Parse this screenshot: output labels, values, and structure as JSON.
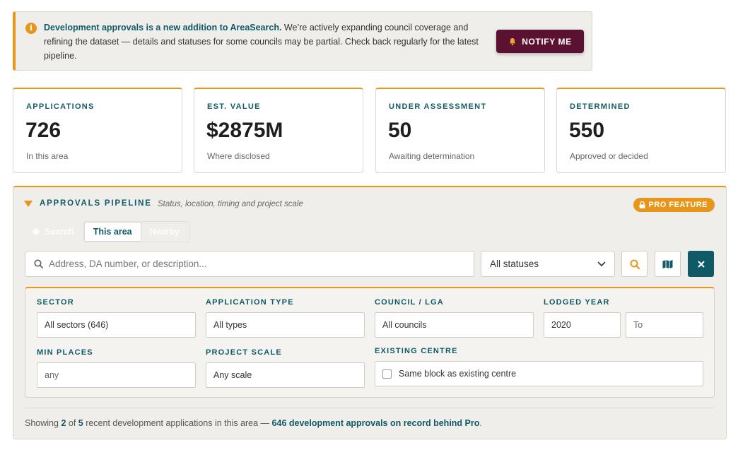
{
  "banner": {
    "icon": "info-icon",
    "headline": "Development approvals is a new addition to AreaSearch.",
    "body": " We’re actively expanding council coverage and refining the dataset — details and statuses for some councils may be partial. Check back regularly for the latest pipeline.",
    "button_label": "NOTIFY ME",
    "button_icon": "bell-icon"
  },
  "stats": [
    {
      "label": "APPLICATIONS",
      "value": "726",
      "sub": "In this area"
    },
    {
      "label": "EST. VALUE",
      "value": "$2875M",
      "sub": "Where disclosed"
    },
    {
      "label": "UNDER ASSESSMENT",
      "value": "50",
      "sub": "Awaiting determination"
    },
    {
      "label": "DETERMINED",
      "value": "550",
      "sub": "Approved or decided"
    }
  ],
  "panel": {
    "title": "APPROVALS PIPELINE",
    "subtitle": "Status, location, timing and project scale",
    "badge": "PRO FEATURE",
    "tabs": [
      "Search",
      "This area",
      "Nearby"
    ],
    "active_tab": "This area",
    "search_placeholder": "Address, DA number, or description...",
    "status_value": "All statuses",
    "filters": {
      "sector_label": "SECTOR",
      "sector_value": "All sectors (646)",
      "app_type_label": "APPLICATION TYPE",
      "app_type_value": "All types",
      "council_label": "COUNCIL / LGA",
      "council_value": "All councils",
      "lodged_label": "LODGED YEAR",
      "lodged_from": "2020",
      "lodged_to_placeholder": "To",
      "min_places_label": "MIN PLACES",
      "min_places_placeholder": "any",
      "scale_label": "PROJECT SCALE",
      "scale_value": "Any scale",
      "centre_label": "EXISTING CENTRE",
      "centre_checkbox": "Same block as existing centre"
    },
    "footer": {
      "prefix": "Showing ",
      "shown": "2",
      "of": " of ",
      "total": "5",
      "middle": " recent development applications in this area — ",
      "link": "646 development approvals on record behind Pro",
      "suffix": "."
    }
  },
  "colors": {
    "accent": "#e8961b",
    "teal": "#0f5a66",
    "maroon": "#5a1230"
  }
}
